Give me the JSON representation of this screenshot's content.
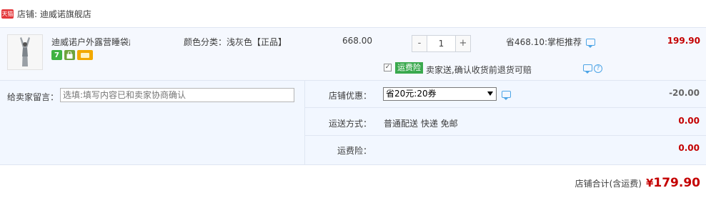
{
  "shop": {
    "badge": "天猫",
    "label": "店铺: 迪威诺旗舰店"
  },
  "item": {
    "title": "迪威诺户外露营睡袋成人秋冬季...",
    "spec": "颜色分类：浅灰色【正品】",
    "unit_price": "668.00",
    "qty_minus": "-",
    "quantity": "1",
    "qty_plus": "+",
    "discount": "省468.10:掌柜推荐",
    "subtotal": "199.90",
    "icons": [
      "seven-day-return-icon",
      "bag-icon",
      "card-icon"
    ],
    "seven_label": "7"
  },
  "message": {
    "label": "给卖家留言：",
    "placeholder": "选填:填写内容已和卖家协商确认"
  },
  "shop_discount": {
    "label": "店铺优惠：",
    "selected": "省20元:20券",
    "amount": "-20.00"
  },
  "shipping": {
    "label": "运送方式：",
    "value": "普通配送 快递 免邮",
    "amount": "0.00"
  },
  "insurance": {
    "label": "运费险：",
    "checkbox": "✓",
    "badge": "运费险",
    "text": "卖家送,确认收货前退货可赔",
    "amount": "0.00",
    "help": "?"
  },
  "total": {
    "label": "店铺合计(含运费)",
    "currency": "¥",
    "amount": "179.90"
  },
  "colors": {
    "accent_red": "#c40000",
    "row_bg": "#f5f8fe",
    "panel_bg": "#f2f7ff",
    "tmall_red": "#e4393c",
    "insurance_green": "#3aa94e"
  }
}
